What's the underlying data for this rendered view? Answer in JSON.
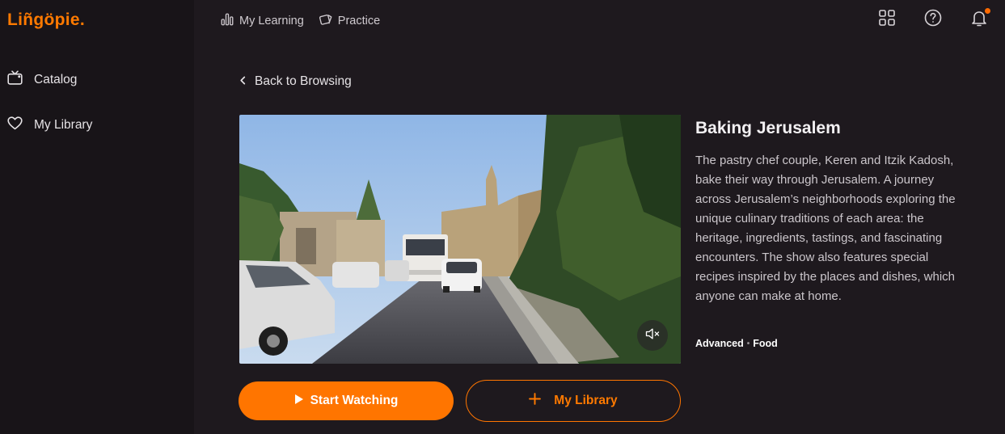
{
  "brand": {
    "logo_text": "Liñgöpie.",
    "accent_color": "#ff7500"
  },
  "sidebar": {
    "items": [
      {
        "label": "Catalog",
        "icon": "tv-icon"
      },
      {
        "label": "My Library",
        "icon": "heart-icon"
      }
    ]
  },
  "topnav": {
    "items": [
      {
        "label": "My Learning",
        "icon": "bar-chart-icon"
      },
      {
        "label": "Practice",
        "icon": "cards-icon"
      }
    ],
    "right_icons": [
      "grid-icon",
      "help-icon",
      "bell-icon"
    ]
  },
  "back": {
    "label": "Back to Browsing"
  },
  "show": {
    "title": "Baking Jerusalem",
    "description": "The pastry chef couple, Keren and Itzik Kadosh, bake their way through Jerusalem. A journey across Jerusalem’s neighborhoods exploring the unique culinary traditions of each area: the heritage, ingredients, tastings, and fascinating encounters. The show also features special recipes inspired by the places and dishes, which anyone can make at home.",
    "level": "Advanced",
    "separator": "•",
    "category": "Food"
  },
  "actions": {
    "start_label": "Start Watching",
    "library_label": "My Library"
  },
  "video": {
    "muted": true
  }
}
